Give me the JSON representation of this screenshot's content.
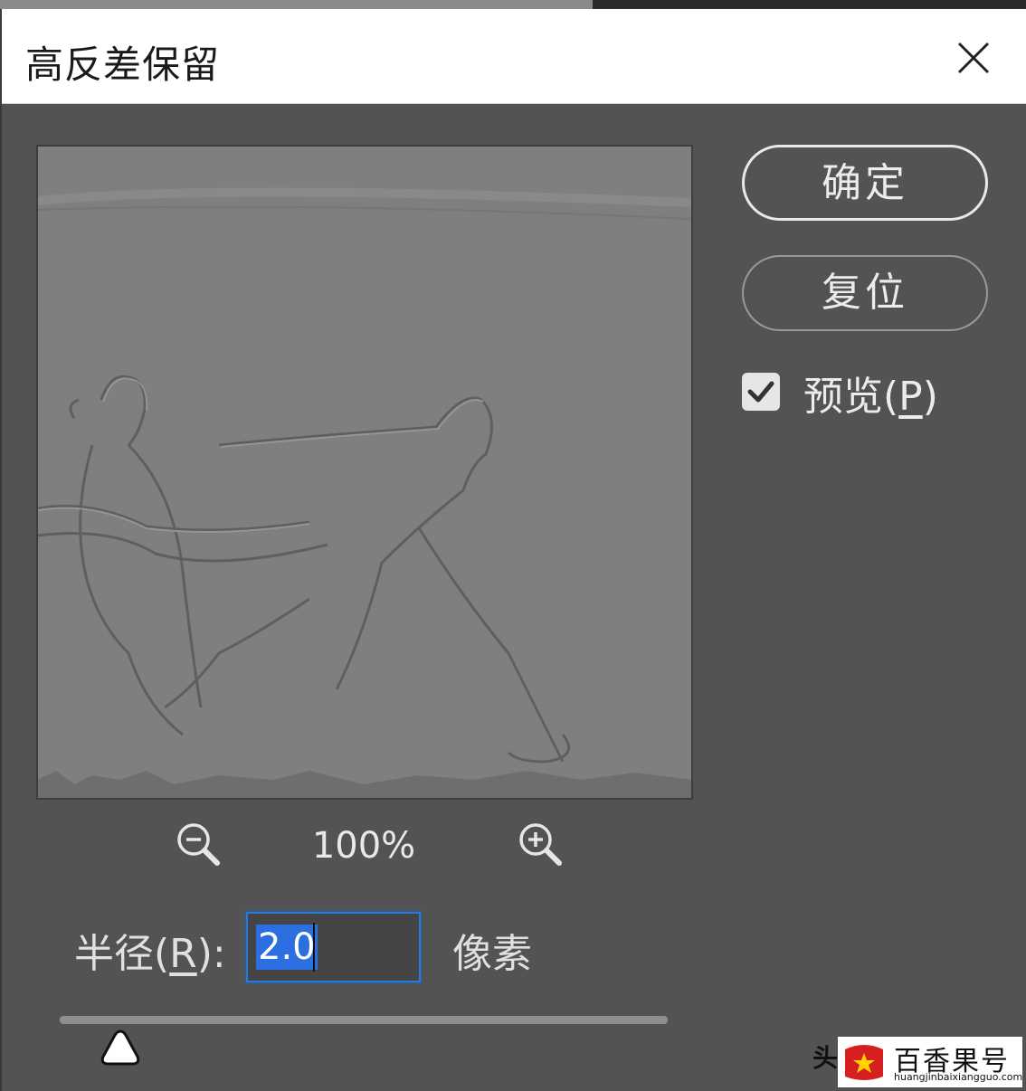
{
  "dialog": {
    "title": "高反差保留",
    "close_icon": "close-icon"
  },
  "buttons": {
    "ok_label": "确定",
    "reset_label": "复位"
  },
  "preview_option": {
    "label_main": "预览(",
    "label_key": "P",
    "label_end": ")",
    "checked": true
  },
  "zoom": {
    "level": "100%",
    "zoom_out_icon": "zoom-out-icon",
    "zoom_in_icon": "zoom-in-icon"
  },
  "radius": {
    "label_main": "半径(",
    "label_key": "R",
    "label_end": "):",
    "value": "2.0",
    "unit": "像素",
    "slider_fraction": 0.1
  },
  "colors": {
    "dialog_bg": "#535353",
    "title_bg": "#ffffff",
    "focus_blue": "#2a7ad8",
    "selection_blue": "#2c6fe0"
  },
  "watermark": {
    "prefix": "头",
    "name": "百香果号",
    "url": "huangjinbaixiangguo.com"
  }
}
